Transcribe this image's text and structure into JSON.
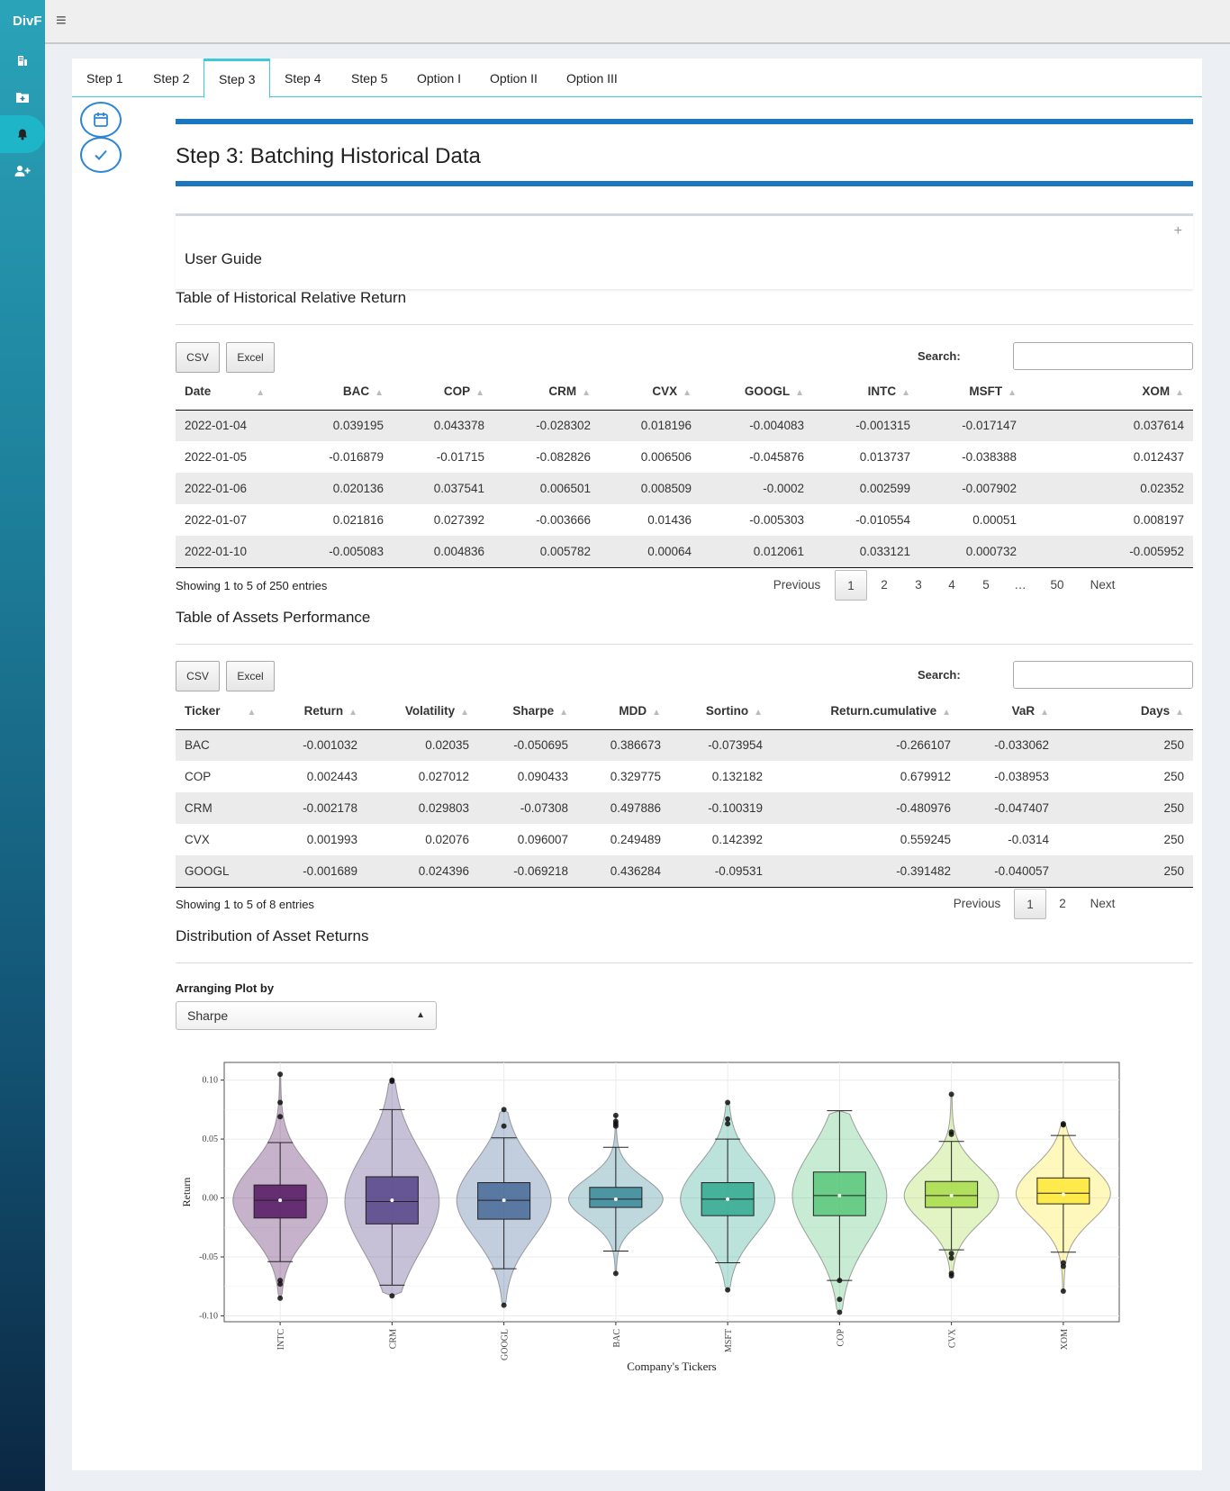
{
  "app": {
    "brand": "DivF"
  },
  "tabs": [
    {
      "label": "Step 1"
    },
    {
      "label": "Step 2"
    },
    {
      "label": "Step 3"
    },
    {
      "label": "Step 4"
    },
    {
      "label": "Step 5"
    },
    {
      "label": "Option I"
    },
    {
      "label": "Option II"
    },
    {
      "label": "Option III"
    }
  ],
  "active_tab": "Step 3",
  "page_title": "Step 3: Batching Historical Data",
  "user_guide": {
    "title": "User Guide",
    "toggle": "+"
  },
  "returns_table": {
    "title": "Table of Historical Relative Return",
    "buttons": {
      "csv": "CSV",
      "excel": "Excel"
    },
    "search_label": "Search:",
    "columns": [
      "Date",
      "BAC",
      "COP",
      "CRM",
      "CVX",
      "GOOGL",
      "INTC",
      "MSFT",
      "XOM"
    ],
    "rows": [
      [
        "2022-01-04",
        "0.039195",
        "0.043378",
        "-0.028302",
        "0.018196",
        "-0.004083",
        "-0.001315",
        "-0.017147",
        "0.037614"
      ],
      [
        "2022-01-05",
        "-0.016879",
        "-0.01715",
        "-0.082826",
        "0.006506",
        "-0.045876",
        "0.013737",
        "-0.038388",
        "0.012437"
      ],
      [
        "2022-01-06",
        "0.020136",
        "0.037541",
        "0.006501",
        "0.008509",
        "-0.0002",
        "0.002599",
        "-0.007902",
        "0.02352"
      ],
      [
        "2022-01-07",
        "0.021816",
        "0.027392",
        "-0.003666",
        "0.01436",
        "-0.005303",
        "-0.010554",
        "0.00051",
        "0.008197"
      ],
      [
        "2022-01-10",
        "-0.005083",
        "0.004836",
        "0.005782",
        "0.00064",
        "0.012061",
        "0.033121",
        "0.000732",
        "-0.005952"
      ]
    ],
    "info": "Showing 1 to 5 of 250 entries",
    "pagination": {
      "previous": "Previous",
      "pages": [
        "1",
        "2",
        "3",
        "4",
        "5",
        "…",
        "50"
      ],
      "next": "Next",
      "current": "1"
    }
  },
  "performance_table": {
    "title": "Table of Assets Performance",
    "buttons": {
      "csv": "CSV",
      "excel": "Excel"
    },
    "search_label": "Search:",
    "columns": [
      "Ticker",
      "Return",
      "Volatility",
      "Sharpe",
      "MDD",
      "Sortino",
      "Return.cumulative",
      "VaR",
      "Days"
    ],
    "rows": [
      [
        "BAC",
        "-0.001032",
        "0.02035",
        "-0.050695",
        "0.386673",
        "-0.073954",
        "-0.266107",
        "-0.033062",
        "250"
      ],
      [
        "COP",
        "0.002443",
        "0.027012",
        "0.090433",
        "0.329775",
        "0.132182",
        "0.679912",
        "-0.038953",
        "250"
      ],
      [
        "CRM",
        "-0.002178",
        "0.029803",
        "-0.07308",
        "0.497886",
        "-0.100319",
        "-0.480976",
        "-0.047407",
        "250"
      ],
      [
        "CVX",
        "0.001993",
        "0.02076",
        "0.096007",
        "0.249489",
        "0.142392",
        "0.559245",
        "-0.0314",
        "250"
      ],
      [
        "GOOGL",
        "-0.001689",
        "0.024396",
        "-0.069218",
        "0.436284",
        "-0.09531",
        "-0.391482",
        "-0.040057",
        "250"
      ]
    ],
    "info": "Showing 1 to 5 of 8 entries",
    "pagination": {
      "previous": "Previous",
      "pages": [
        "1",
        "2"
      ],
      "next": "Next",
      "current": "1"
    }
  },
  "distribution": {
    "title": "Distribution of Asset Returns",
    "arrange_label": "Arranging Plot by",
    "arrange_value": "Sharpe"
  },
  "chart_data": {
    "type": "violin-box",
    "xlabel": "Company's Tickers",
    "ylabel": "Return",
    "ylim": [
      -0.105,
      0.115
    ],
    "yticks": [
      -0.1,
      -0.05,
      0.0,
      0.05,
      0.1
    ],
    "ytick_labels": [
      "-0.10",
      "-0.05",
      "0.00",
      "0.05",
      "0.10"
    ],
    "grid": true,
    "categories": [
      "INTC",
      "CRM",
      "GOOGL",
      "BAC",
      "MSFT",
      "COP",
      "CVX",
      "XOM"
    ],
    "colors": [
      "#440154",
      "#46337e",
      "#365c8d",
      "#277f8e",
      "#1fa187",
      "#4ac16d",
      "#a0da39",
      "#fde725"
    ],
    "series": [
      {
        "category": "INTC",
        "q1": -0.017,
        "median": -0.002,
        "q3": 0.011,
        "whisker_low": -0.054,
        "whisker_high": 0.047,
        "mean": -0.002,
        "violin_min": -0.085,
        "violin_max": 0.105,
        "outliers": [
          0.105,
          0.081,
          0.069,
          -0.07,
          -0.073,
          -0.085
        ]
      },
      {
        "category": "CRM",
        "q1": -0.022,
        "median": -0.003,
        "q3": 0.018,
        "whisker_low": -0.074,
        "whisker_high": 0.075,
        "mean": -0.002,
        "violin_min": -0.083,
        "violin_max": 0.1,
        "outliers": [
          0.1,
          0.099,
          -0.083
        ]
      },
      {
        "category": "GOOGL",
        "q1": -0.018,
        "median": -0.002,
        "q3": 0.013,
        "whisker_low": -0.06,
        "whisker_high": 0.051,
        "mean": -0.002,
        "violin_min": -0.091,
        "violin_max": 0.075,
        "outliers": [
          0.075,
          0.061,
          -0.091
        ]
      },
      {
        "category": "BAC",
        "q1": -0.008,
        "median": -0.001,
        "q3": 0.009,
        "whisker_low": -0.045,
        "whisker_high": 0.043,
        "mean": -0.001,
        "violin_min": -0.064,
        "violin_max": 0.07,
        "outliers": [
          0.07,
          0.065,
          0.063,
          0.061,
          -0.064
        ]
      },
      {
        "category": "MSFT",
        "q1": -0.015,
        "median": -0.001,
        "q3": 0.013,
        "whisker_low": -0.055,
        "whisker_high": 0.05,
        "mean": -0.001,
        "violin_min": -0.078,
        "violin_max": 0.081,
        "outliers": [
          0.081,
          0.067,
          0.063,
          -0.078
        ]
      },
      {
        "category": "COP",
        "q1": -0.015,
        "median": 0.002,
        "q3": 0.022,
        "whisker_low": -0.07,
        "whisker_high": 0.074,
        "mean": 0.002,
        "violin_min": -0.097,
        "violin_max": 0.074,
        "outliers": [
          -0.07,
          -0.086,
          -0.097
        ]
      },
      {
        "category": "CVX",
        "q1": -0.008,
        "median": 0.002,
        "q3": 0.014,
        "whisker_low": -0.044,
        "whisker_high": 0.048,
        "mean": 0.002,
        "violin_min": -0.067,
        "violin_max": 0.088,
        "outliers": [
          0.088,
          0.056,
          0.054,
          -0.047,
          -0.051,
          -0.064,
          -0.066
        ]
      },
      {
        "category": "XOM",
        "q1": -0.005,
        "median": 0.004,
        "q3": 0.017,
        "whisker_low": -0.046,
        "whisker_high": 0.053,
        "mean": 0.003,
        "violin_min": -0.079,
        "violin_max": 0.063,
        "outliers": [
          0.063,
          0.062,
          -0.055,
          -0.058,
          -0.079
        ]
      }
    ]
  }
}
